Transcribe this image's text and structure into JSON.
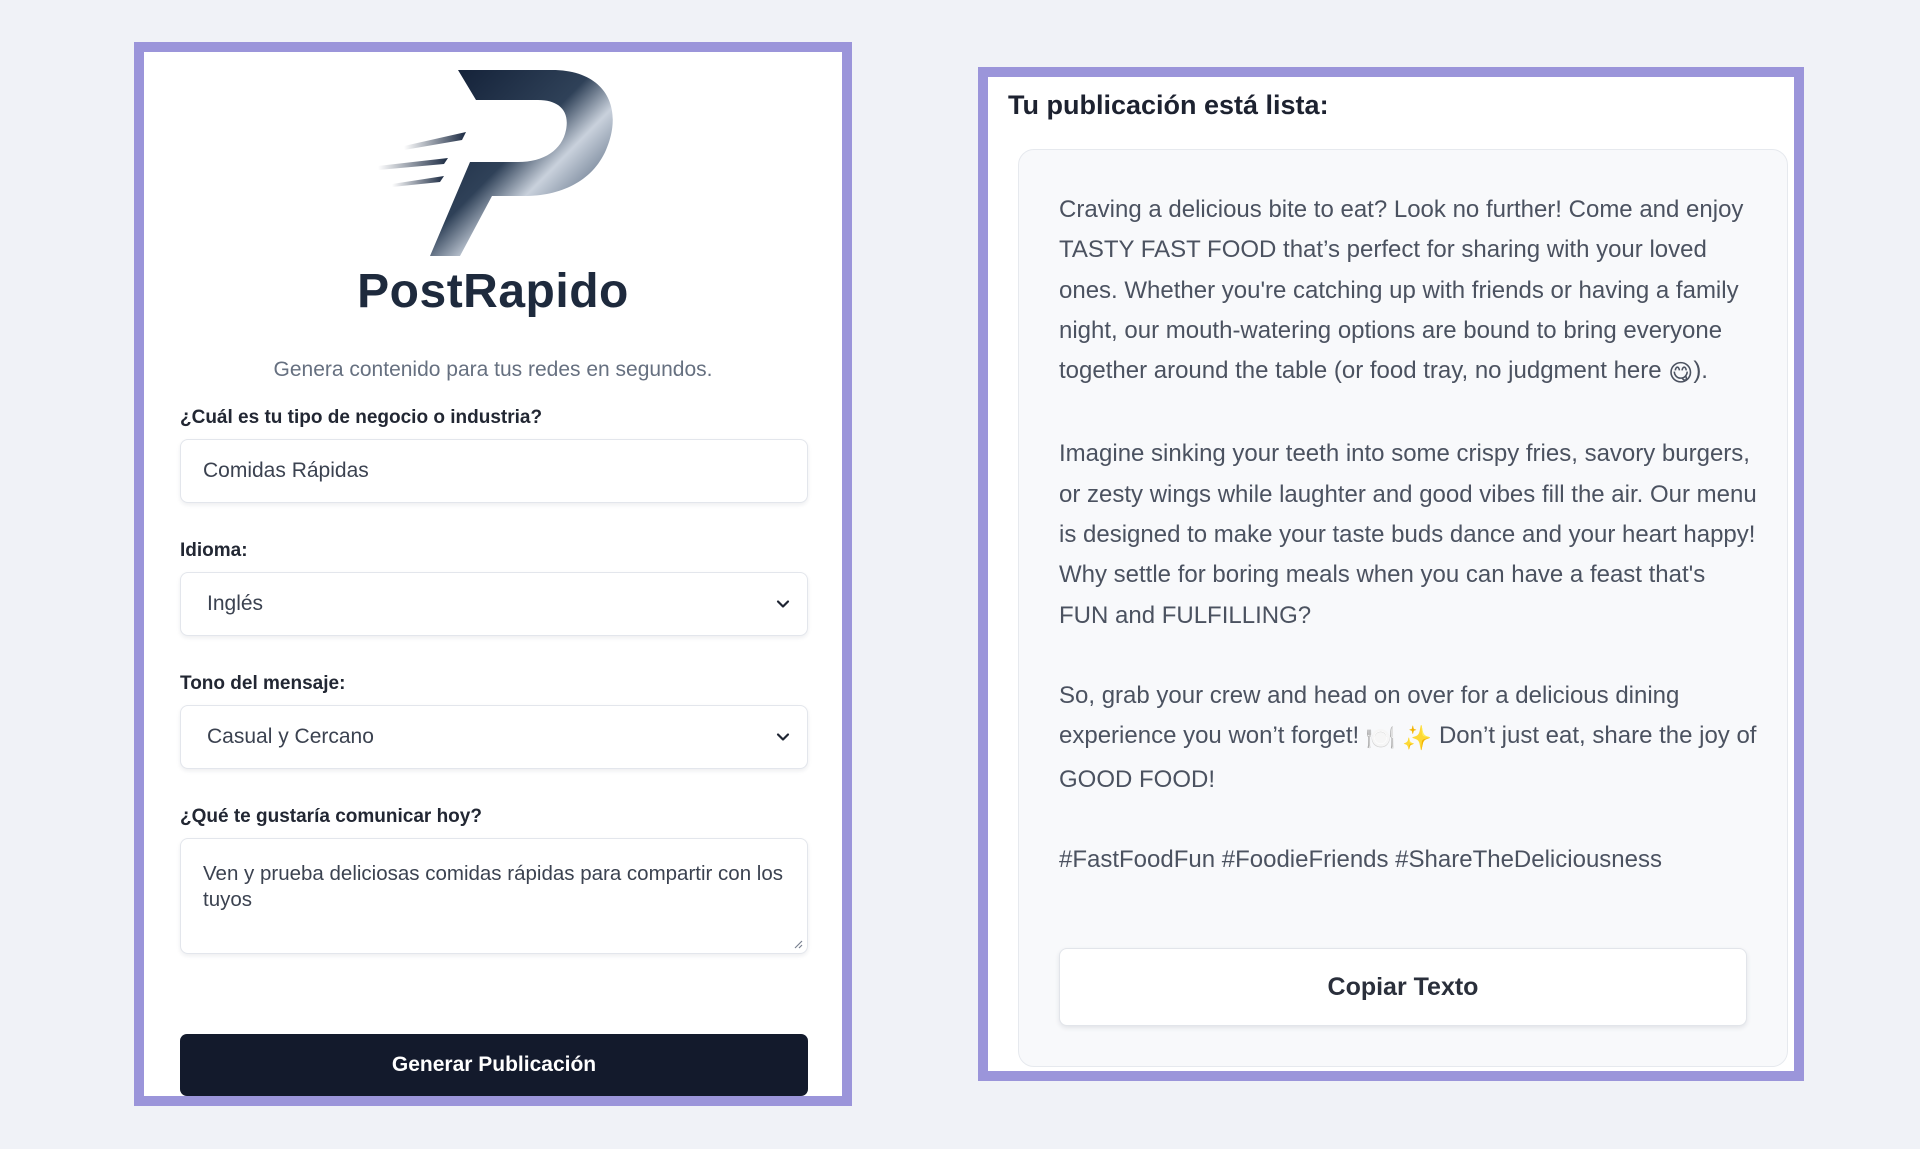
{
  "brand": {
    "name": "PostRapido",
    "tagline": "Genera contenido para tus redes en segundos."
  },
  "form": {
    "industry": {
      "label": "¿Cuál es tu tipo de negocio o industria?",
      "value": "Comidas Rápidas"
    },
    "language": {
      "label": "Idioma:",
      "value": "Inglés"
    },
    "tone": {
      "label": "Tono del mensaje:",
      "value": "Casual y Cercano"
    },
    "message": {
      "label": "¿Qué te gustaría comunicar hoy?",
      "value": "Ven y prueba deliciosas comidas rápidas para compartir con los tuyos"
    },
    "submit_label": "Generar Publicación"
  },
  "result": {
    "title": "Tu publicación está lista:",
    "paragraphs": {
      "p1_text": "Craving a delicious bite to eat? Look no further! Come and enjoy TASTY FAST FOOD that’s perfect for sharing with your loved ones. Whether you're catching up with friends or having a family night, our mouth-watering options are bound to bring everyone together around the table (or food tray, no judgment here ",
      "p1_emoji": "😋",
      "p1_end": ").",
      "p2": "Imagine sinking your teeth into some crispy fries, savory burgers, or zesty wings while laughter and good vibes fill the air. Our menu is designed to make your taste buds dance and your heart happy! Why settle for boring meals when you can have a feast that's FUN and FULFILLING?",
      "p3_text": "So, grab your crew and head on over for a delicious dining experience you won’t forget! ",
      "p3_emoji1": "🍽️",
      "p3_emoji2": "✨",
      "p3_end": " Don’t just eat, share the joy of GOOD FOOD!",
      "hashtags": "#FastFoodFun #FoodieFriends #ShareTheDeliciousness"
    },
    "copy_label": "Copiar Texto"
  },
  "colors": {
    "page_bg": "#f0f2f7",
    "card_border": "#9b95da",
    "primary_button": "#131a2c"
  }
}
